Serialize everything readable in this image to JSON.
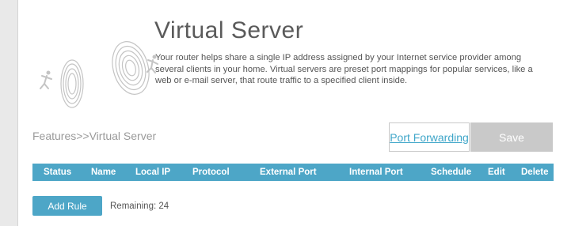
{
  "page": {
    "title": "Virtual Server",
    "description": "Your router helps share a single IP address assigned by your Internet service provider among several clients in your home. Virtual servers are preset port mappings for popular services, like a web or e-mail server, that route traffic to a specified client inside."
  },
  "breadcrumb": "Features>>Virtual Server",
  "actions": {
    "port_forwarding_label": "Port Forwarding",
    "save_label": "Save"
  },
  "table": {
    "columns": [
      "Status",
      "Name",
      "Local IP",
      "Protocol",
      "External Port",
      "Internal Port",
      "Schedule",
      "Edit",
      "Delete"
    ]
  },
  "rules": {
    "add_label": "Add Rule",
    "remaining_label": "Remaining:",
    "remaining_count": "24"
  },
  "colors": {
    "accent": "#4da6c7",
    "link": "#3fa6c9",
    "save_disabled": "#c9c9c9"
  },
  "icons": [
    "running-person-icon",
    "spiral-portal-icon"
  ]
}
